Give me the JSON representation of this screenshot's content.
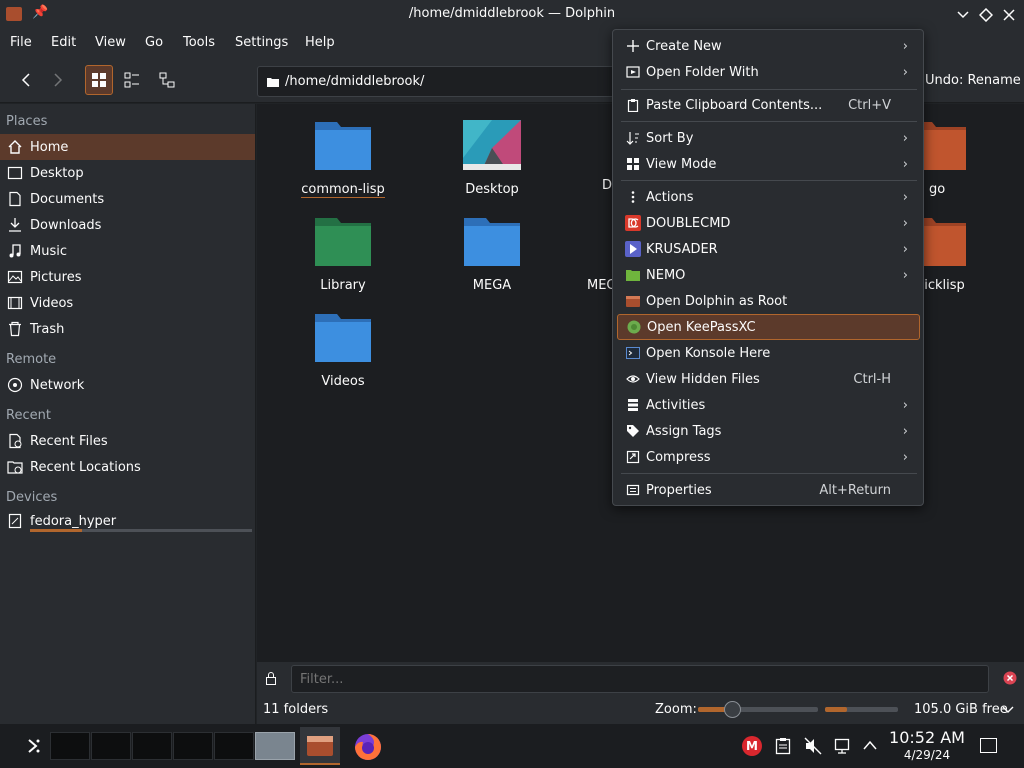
{
  "window": {
    "title": "/home/dmiddlebrook — Dolphin"
  },
  "menubar": [
    "File",
    "Edit",
    "View",
    "Go",
    "Tools",
    "Settings",
    "Help"
  ],
  "toolbar": {
    "path": "/home/dmiddlebrook/",
    "undo_label": "Undo: Rename"
  },
  "sidebar": {
    "places_header": "Places",
    "places": [
      "Home",
      "Desktop",
      "Documents",
      "Downloads",
      "Music",
      "Pictures",
      "Videos",
      "Trash"
    ],
    "remote_header": "Remote",
    "remote": [
      "Network"
    ],
    "recent_header": "Recent",
    "recent": [
      "Recent Files",
      "Recent Locations"
    ],
    "devices_header": "Devices",
    "devices": [
      "fedora_hyper"
    ]
  },
  "files": {
    "common_lisp": "common-lisp",
    "desktop": "Desktop",
    "d_partial": "D",
    "go": "go",
    "library": "Library",
    "mega": "MEGA",
    "meg_partial": "MEG",
    "quicklisp_partial": "uicklisp",
    "videos": "Videos"
  },
  "filter": {
    "placeholder": "Filter..."
  },
  "status": {
    "folders": "11 folders",
    "zoom_label": "Zoom:",
    "free": "105.0 GiB free"
  },
  "context_menu": {
    "create_new": "Create New",
    "open_folder_with": "Open Folder With",
    "paste": "Paste Clipboard Contents...",
    "paste_shortcut": "Ctrl+V",
    "sort_by": "Sort By",
    "view_mode": "View Mode",
    "actions": "Actions",
    "doublecmd": "DOUBLECMD",
    "krusader": "KRUSADER",
    "nemo": "NEMO",
    "open_root": "Open Dolphin as Root",
    "open_keepass": "Open KeePassXC",
    "open_konsole": "Open Konsole Here",
    "view_hidden": "View Hidden Files",
    "view_hidden_shortcut": "Ctrl-H",
    "activities": "Activities",
    "assign_tags": "Assign Tags",
    "compress": "Compress",
    "properties": "Properties",
    "properties_shortcut": "Alt+Return"
  },
  "taskbar": {
    "time": "10:52 AM",
    "date": "4/29/24"
  },
  "colors": {
    "accent": "#b1662d",
    "folder_blue": "#3d8fe0",
    "folder_green": "#2f8f55",
    "folder_orange": "#c0552e"
  }
}
